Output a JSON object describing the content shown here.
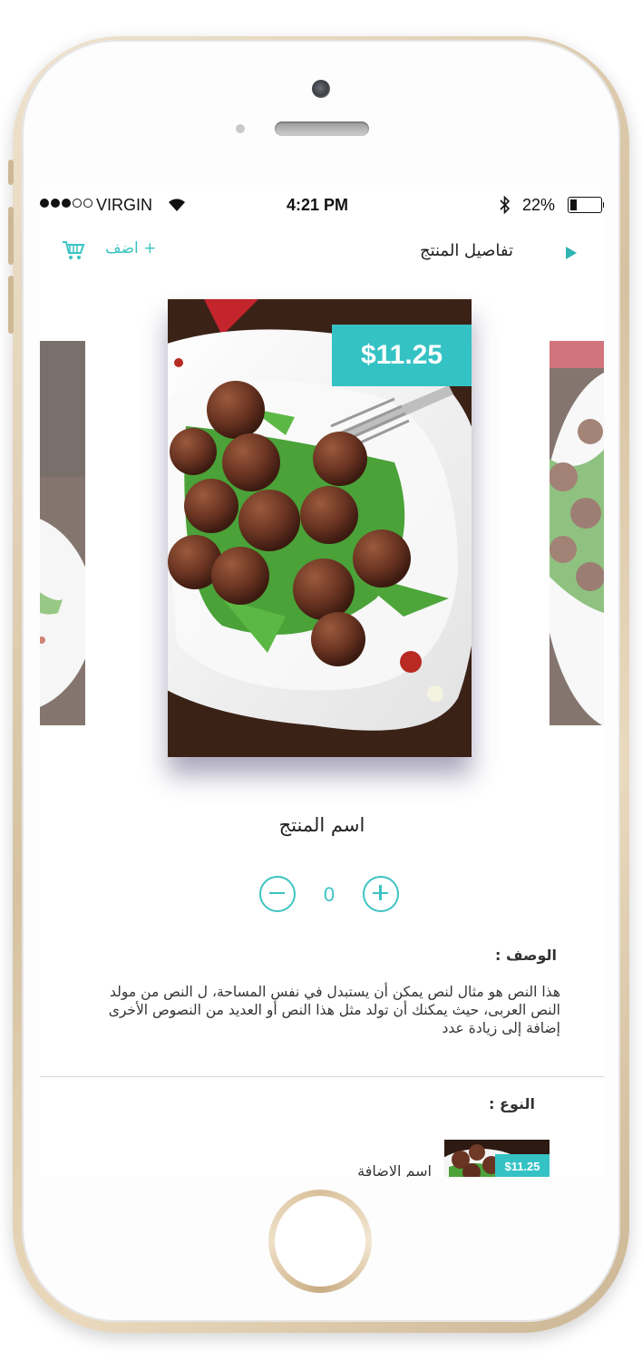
{
  "status_bar": {
    "carrier": "VIRGIN",
    "time": "4:21 PM",
    "battery_percent": "22%",
    "battery_level": 0.22,
    "signal_strength": 3
  },
  "nav": {
    "title": "تفاصيل المنتج",
    "add_label": "+ اضف",
    "cart_icon": "cart-icon",
    "play_icon": "play-icon"
  },
  "product": {
    "price": "$11.25",
    "name": "اسم المنتج",
    "quantity": "0"
  },
  "description": {
    "label": "الوصف :",
    "text": "هذا النص هو مثال لنص يمكن أن يستبدل في نفس المساحة، ل النص من مولد النص العربى، حيث يمكنك أن تولد مثل هذا النص أو العديد من النصوص الأخرى إضافة إلى زيادة عدد"
  },
  "type_section": {
    "label": "النوع :",
    "addon": {
      "name": "اسم الاضافة",
      "price": "$11.25"
    }
  },
  "colors": {
    "accent": "#34c2c4",
    "text": "#333333"
  }
}
